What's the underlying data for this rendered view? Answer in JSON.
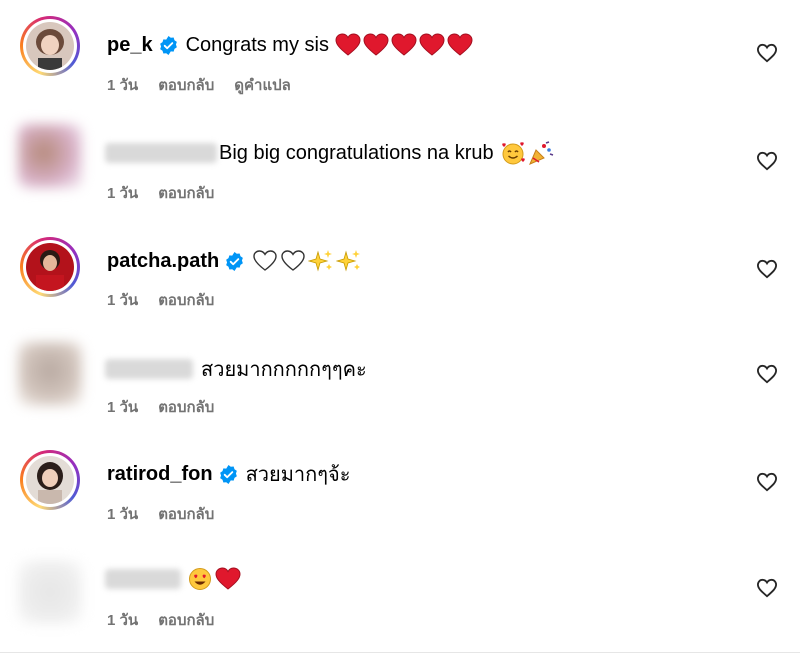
{
  "comments": [
    {
      "username": "pe_k",
      "verified": true,
      "text": "Congrats my sis",
      "emojis": [
        "red-heart",
        "red-heart",
        "red-heart",
        "red-heart",
        "red-heart"
      ],
      "time": "1 วัน",
      "reply": "ตอบกลับ",
      "translate": "ดูคำแปล",
      "blurred": false
    },
    {
      "username": "",
      "verified": false,
      "text": "Big big congratulations na krub",
      "emojis": [
        "smiling-face-hearts",
        "party-popper"
      ],
      "time": "1 วัน",
      "reply": "ตอบกลับ",
      "blurred": true
    },
    {
      "username": "patcha.path",
      "verified": true,
      "text": "",
      "emojis": [
        "white-heart",
        "white-heart",
        "sparkles",
        "sparkles"
      ],
      "time": "1 วัน",
      "reply": "ตอบกลับ",
      "blurred": false
    },
    {
      "username": "",
      "verified": false,
      "text": "สวยมากกกกกๆๆคะ",
      "emojis": [],
      "time": "1 วัน",
      "reply": "ตอบกลับ",
      "blurred": true
    },
    {
      "username": "ratirod_fon",
      "verified": true,
      "text": "สวยมากๆจ้ะ",
      "emojis": [],
      "time": "1 วัน",
      "reply": "ตอบกลับ",
      "blurred": false
    },
    {
      "username": "",
      "verified": false,
      "text": "",
      "emojis": [
        "heart-eyes-face",
        "red-heart"
      ],
      "time": "1 วัน",
      "reply": "ตอบกลับ",
      "blurred": true
    }
  ],
  "colors": {
    "verified_blue": "#0095f6",
    "meta_gray": "#737373",
    "heart_red": "#e0182d"
  },
  "icons": {
    "like": "heart-outline-icon",
    "verified": "verified-badge-icon"
  }
}
